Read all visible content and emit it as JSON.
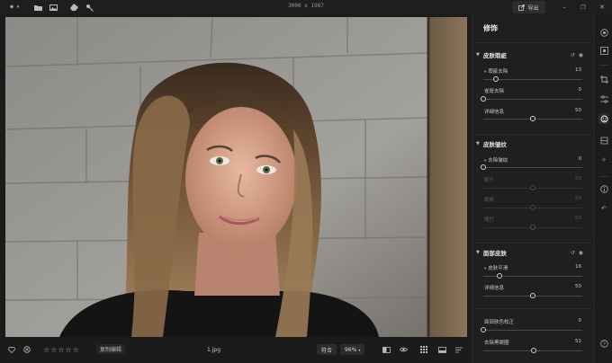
{
  "window": {
    "title": "3000 x 1987",
    "export_label": "导出"
  },
  "panel": {
    "title": "修饰",
    "sections": [
      {
        "title": "皮肤瑕疵",
        "rows": [
          {
            "label": "瑕疵去除",
            "value": "13",
            "fraction": 0.13,
            "sub": true
          },
          {
            "label": "雀斑去除",
            "value": "0",
            "fraction": 0.0
          },
          {
            "label": "详细信息",
            "value": "50",
            "fraction": 0.5
          }
        ]
      },
      {
        "title": "皮肤皱纹",
        "rows": [
          {
            "label": "去除皱纹",
            "value": "0",
            "fraction": 0.0,
            "sub": true
          },
          {
            "label": "额头",
            "value": "50",
            "fraction": 0.5,
            "dim": true
          },
          {
            "label": "眼睛",
            "value": "50",
            "fraction": 0.5,
            "dim": true
          },
          {
            "label": "嘴巴",
            "value": "50",
            "fraction": 0.5,
            "dim": true
          }
        ]
      },
      {
        "title": "面部皮肤",
        "rows": [
          {
            "label": "皮肤平滑",
            "value": "16",
            "fraction": 0.16,
            "sub": true
          },
          {
            "label": "详细信息",
            "value": "50",
            "fraction": 0.5
          },
          {
            "label": "面部肤色校正",
            "value": "0",
            "fraction": 0.0
          },
          {
            "label": "去除黑眼圈",
            "value": "51",
            "fraction": 0.51
          }
        ]
      }
    ]
  },
  "bottombar": {
    "copy_label": "复制编辑",
    "filename": "1.jpg",
    "fit_label": "符合",
    "zoom_label": "96%",
    "rating": 0
  },
  "icons": {
    "logo": "sparkle-icon",
    "folder": "folder-icon",
    "image": "image-icon",
    "eraser": "eraser-icon",
    "wand": "magic-wand-icon"
  },
  "colors": {
    "bg": "#1b1b1b",
    "panel": "#1f1f1f",
    "accent_knob": "#cfcfcf"
  }
}
